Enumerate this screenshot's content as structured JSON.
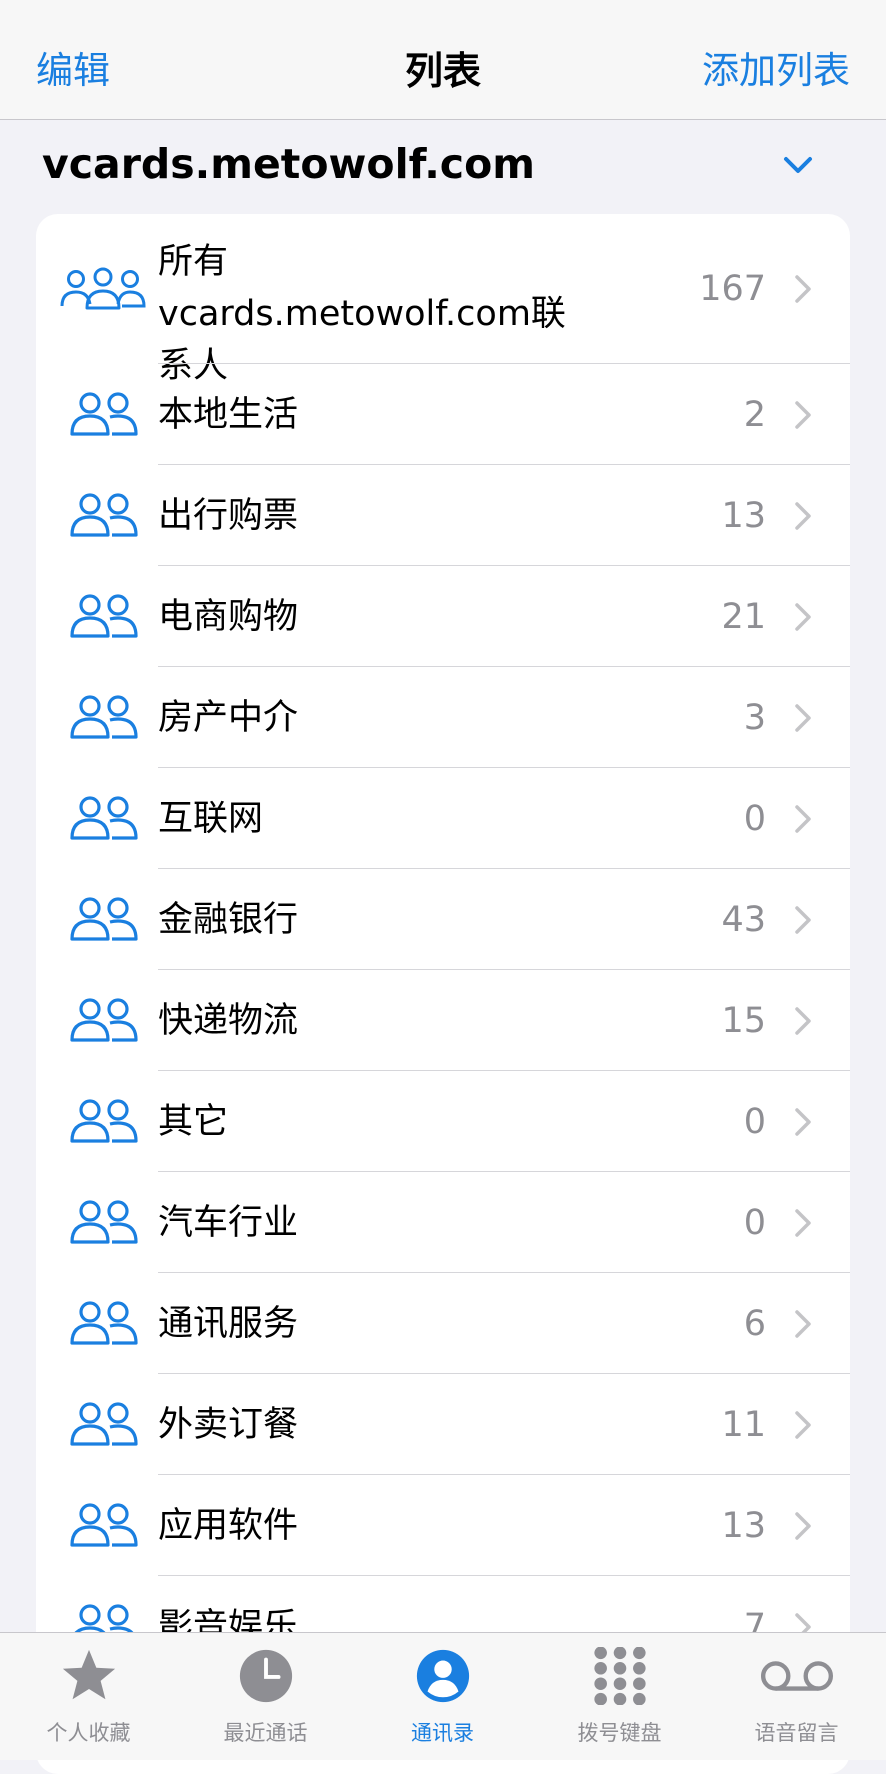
{
  "navbar": {
    "edit_label": "编辑",
    "title": "列表",
    "add_list_label": "添加列表"
  },
  "account": {
    "name": "vcards.metowolf.com",
    "chevron_icon": "chevron-down-icon"
  },
  "colors": {
    "accent": "#1a7fe0",
    "secondary_text": "#8e8e93",
    "background": "#f2f2f7"
  },
  "groups": [
    {
      "label": "所有 vcards.metowolf.com联系人",
      "count": "167",
      "icon": "three-persons-icon"
    },
    {
      "label": "本地生活",
      "count": "2",
      "icon": "two-persons-icon"
    },
    {
      "label": "出行购票",
      "count": "13",
      "icon": "two-persons-icon"
    },
    {
      "label": "电商购物",
      "count": "21",
      "icon": "two-persons-icon"
    },
    {
      "label": "房产中介",
      "count": "3",
      "icon": "two-persons-icon"
    },
    {
      "label": "互联网",
      "count": "0",
      "icon": "two-persons-icon"
    },
    {
      "label": "金融银行",
      "count": "43",
      "icon": "two-persons-icon"
    },
    {
      "label": "快递物流",
      "count": "15",
      "icon": "two-persons-icon"
    },
    {
      "label": "其它",
      "count": "0",
      "icon": "two-persons-icon"
    },
    {
      "label": "汽车行业",
      "count": "0",
      "icon": "two-persons-icon"
    },
    {
      "label": "通讯服务",
      "count": "6",
      "icon": "two-persons-icon"
    },
    {
      "label": "外卖订餐",
      "count": "11",
      "icon": "two-persons-icon"
    },
    {
      "label": "应用软件",
      "count": "13",
      "icon": "two-persons-icon"
    },
    {
      "label": "影音娱乐",
      "count": "7",
      "icon": "two-persons-icon"
    }
  ],
  "tabbar": {
    "tabs": [
      {
        "label": "个人收藏",
        "icon": "star-icon"
      },
      {
        "label": "最近通话",
        "icon": "clock-icon"
      },
      {
        "label": "通讯录",
        "icon": "contact-person-icon",
        "active": true
      },
      {
        "label": "拨号键盘",
        "icon": "keypad-icon"
      },
      {
        "label": "语音留言",
        "icon": "voicemail-icon"
      }
    ]
  }
}
